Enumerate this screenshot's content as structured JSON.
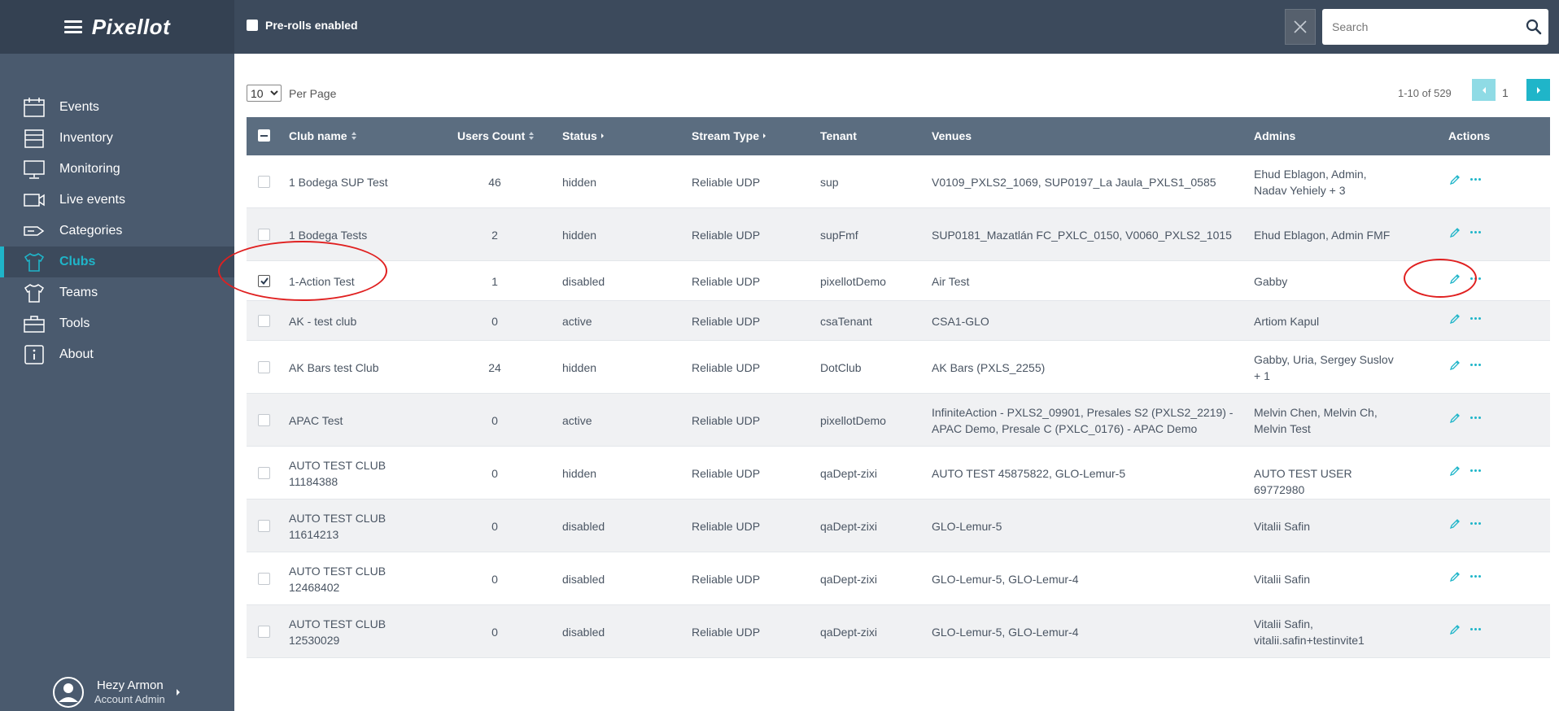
{
  "header": {
    "logo": "Pixellot",
    "preroll_label": "Pre-rolls enabled",
    "search_placeholder": "Search"
  },
  "sidebar": {
    "items": [
      {
        "label": "Events",
        "icon": "calendar-icon"
      },
      {
        "label": "Inventory",
        "icon": "inventory-box-icon"
      },
      {
        "label": "Monitoring",
        "icon": "monitor-icon"
      },
      {
        "label": "Live events",
        "icon": "video-camera-icon"
      },
      {
        "label": "Categories",
        "icon": "tag-icon"
      },
      {
        "label": "Clubs",
        "icon": "shirt-icon",
        "active": true
      },
      {
        "label": "Teams",
        "icon": "team-shirt-icon"
      },
      {
        "label": "Tools",
        "icon": "toolbox-icon"
      },
      {
        "label": "About",
        "icon": "info-icon"
      }
    ],
    "user": {
      "name": "Hezy Armon",
      "role": "Account Admin"
    }
  },
  "toolbar": {
    "per_page_value": "10",
    "per_page_label": "Per Page",
    "range": "1-10 of 529",
    "page": "1"
  },
  "table": {
    "columns": [
      "Club name",
      "Users Count",
      "Status",
      "Stream Type",
      "Tenant",
      "Venues",
      "Admins",
      "Actions"
    ],
    "rows": [
      {
        "name": "1 Bodega SUP Test",
        "users": "46",
        "status": "hidden",
        "stream": "Reliable UDP",
        "tenant": "sup",
        "venues": "V0109_PXLS2_1069, SUP0197_La Jaula_PXLS1_0585",
        "admins": "Ehud Eblagon, Admin, Nadav Yehiely  + 3",
        "checked": false
      },
      {
        "name": "1 Bodega Tests",
        "users": "2",
        "status": "hidden",
        "stream": "Reliable UDP",
        "tenant": "supFmf",
        "venues": "SUP0181_Mazatlán FC_PXLC_0150, V0060_PXLS2_1015",
        "admins": "Ehud Eblagon, Admin FMF",
        "checked": false
      },
      {
        "name": "1-Action Test",
        "users": "1",
        "status": "disabled",
        "stream": "Reliable UDP",
        "tenant": "pixellotDemo",
        "venues": "Air Test",
        "admins": "Gabby",
        "checked": true
      },
      {
        "name": "AK - test club",
        "users": "0",
        "status": "active",
        "stream": "Reliable UDP",
        "tenant": "csaTenant",
        "venues": "CSA1-GLO",
        "admins": "Artiom Kapul",
        "checked": false
      },
      {
        "name": "AK Bars test Club",
        "users": "24",
        "status": "hidden",
        "stream": "Reliable UDP",
        "tenant": "DotClub",
        "venues": "AK Bars (PXLS_2255)",
        "admins": "Gabby, Uria, Sergey Suslov  + 1",
        "checked": false
      },
      {
        "name": "APAC Test",
        "users": "0",
        "status": "active",
        "stream": "Reliable UDP",
        "tenant": "pixellotDemo",
        "venues": "InfiniteAction - PXLS2_09901, Presales S2 (PXLS2_2219) - APAC Demo, Presale C (PXLC_0176) - APAC Demo",
        "admins": "Melvin Chen, Melvin Ch, Melvin Test",
        "checked": false
      },
      {
        "name": "AUTO TEST CLUB 11184388",
        "users": "0",
        "status": "hidden",
        "stream": "Reliable UDP",
        "tenant": "qaDept-zixi",
        "venues": "AUTO TEST 45875822, GLO-Lemur-5",
        "admins": "AUTO TEST USER 69772980",
        "checked": false
      },
      {
        "name": "AUTO TEST CLUB 11614213",
        "users": "0",
        "status": "disabled",
        "stream": "Reliable UDP",
        "tenant": "qaDept-zixi",
        "venues": "GLO-Lemur-5",
        "admins": "Vitalii Safin",
        "checked": false
      },
      {
        "name": "AUTO TEST CLUB 12468402",
        "users": "0",
        "status": "disabled",
        "stream": "Reliable UDP",
        "tenant": "qaDept-zixi",
        "venues": "GLO-Lemur-5, GLO-Lemur-4",
        "admins": "Vitalii Safin",
        "checked": false
      },
      {
        "name": "AUTO TEST CLUB 12530029",
        "users": "0",
        "status": "disabled",
        "stream": "Reliable UDP",
        "tenant": "qaDept-zixi",
        "venues": "GLO-Lemur-5, GLO-Lemur-4",
        "admins": "Vitalii Safin, vitalii.safin+testinvite1",
        "checked": false
      }
    ]
  },
  "colors": {
    "accent": "#1fb5c9",
    "header": "#3c4a5c",
    "sidebar": "#4a5a6e",
    "table_header": "#5b6d80",
    "annotation": "#e02020"
  }
}
